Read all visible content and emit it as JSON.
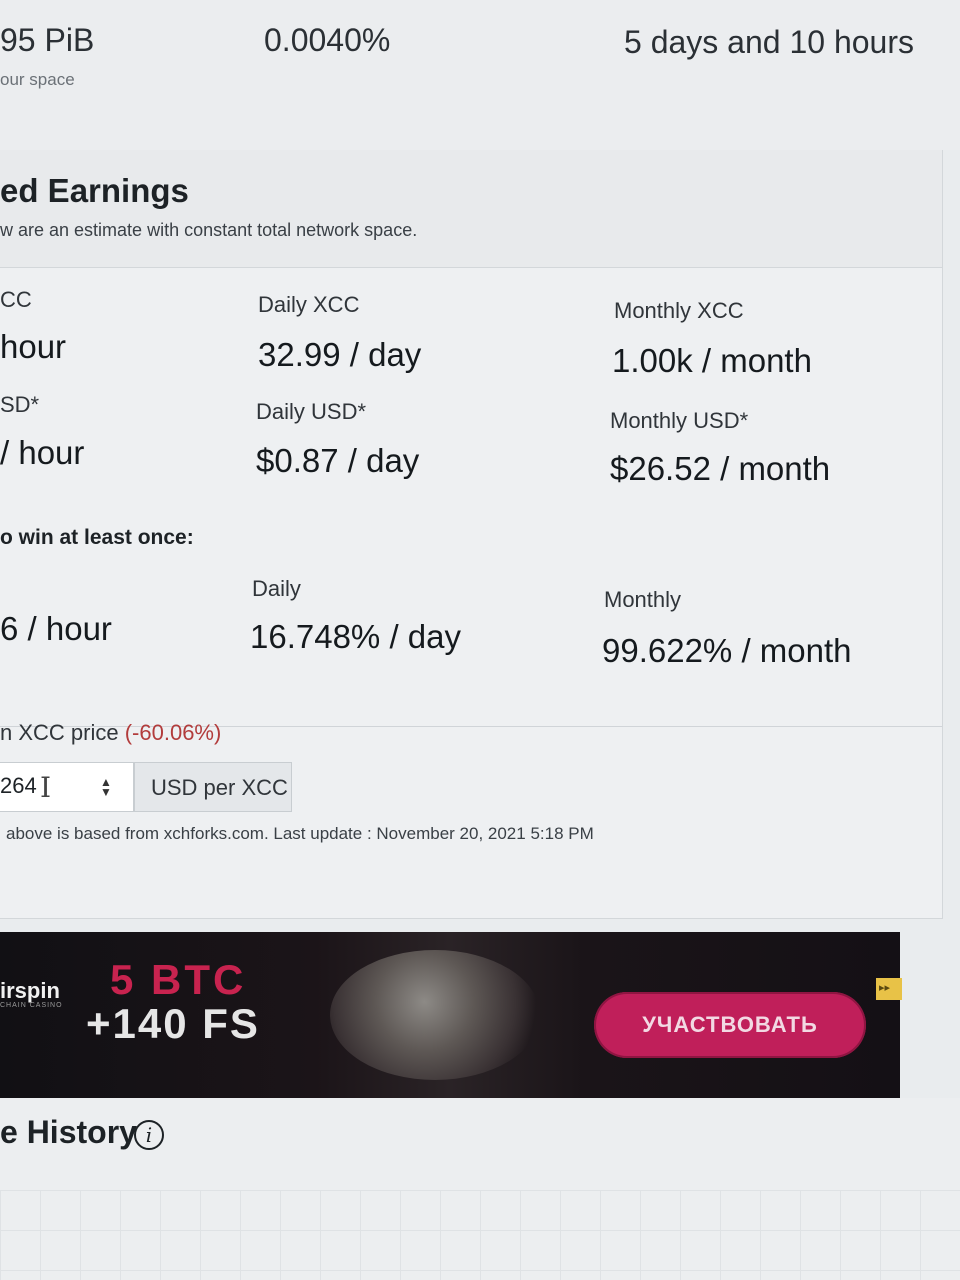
{
  "top_stats": {
    "space_value": "95 PiB",
    "space_label": "our space",
    "percent_value": "0.0040%",
    "time_value": "5 days and 10 hours"
  },
  "earnings": {
    "title": "ed Earnings",
    "subtitle": "w are an estimate with constant total network space.",
    "hourly_xcc_label": "CC",
    "hourly_xcc_value": "hour",
    "daily_xcc_label": "Daily XCC",
    "daily_xcc_value": "32.99 / day",
    "monthly_xcc_label": "Monthly XCC",
    "monthly_xcc_value": "1.00k / month",
    "hourly_usd_label": "SD*",
    "hourly_usd_value": "/ hour",
    "daily_usd_label": "Daily USD*",
    "daily_usd_value": "$0.87 / day",
    "monthly_usd_label": "Monthly USD*",
    "monthly_usd_value": "$26.52 / month"
  },
  "win_chance": {
    "heading": "o win at least once:",
    "hourly_value": "6 / hour",
    "daily_label": "Daily",
    "daily_value": "16.748% / day",
    "monthly_label": "Monthly",
    "monthly_value": "99.622% / month"
  },
  "price": {
    "label": "n XCC price",
    "change": "(-60.06%)",
    "input_value": "264",
    "unit_addon": "USD per XCC",
    "footnote": "above is based from xchforks.com. Last update : November 20, 2021 5:18 PM"
  },
  "banner": {
    "brand": "irspin",
    "brand_sub": "CHAIN CASINO",
    "promo_line1": "5 BTC",
    "promo_line2": "+140 FS",
    "button_label": "УЧАСТВОВАТЬ",
    "corner_badge": "▸▸"
  },
  "history": {
    "title": "e History",
    "info_icon_glyph": "i"
  }
}
